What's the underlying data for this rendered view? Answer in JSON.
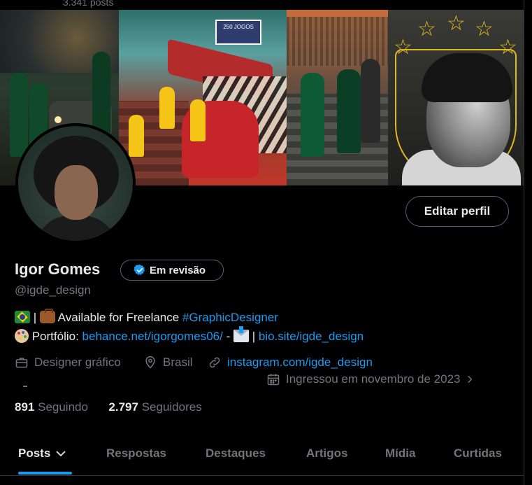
{
  "top": {
    "posts_count": "3.341 posts"
  },
  "banner": {
    "sign_text": "250 JOGOS"
  },
  "profile": {
    "edit_button": "Editar perfil",
    "name": "Igor Gomes",
    "badge": "Em revisão",
    "handle": "@igde_design",
    "bio_line1_sep": " | ",
    "bio_line1_text": " Available for Freelance ",
    "bio_line1_hashtag": "#GraphicDesigner",
    "bio_line2_label": " Portfólio: ",
    "bio_line2_link1": "behance.net/igorgomes06/",
    "bio_line2_dash": " - ",
    "bio_line2_pipe": " | ",
    "bio_line2_link2": "bio.site/igde_design",
    "category": "Designer gráfico",
    "location": "Brasil",
    "website": "instagram.com/igde_design",
    "joined": "Ingressou em novembro de 2023"
  },
  "stats": {
    "following_count": "891",
    "following_label": "Seguindo",
    "followers_count": "2.797",
    "followers_label": "Seguidores"
  },
  "tabs": [
    {
      "label": "Posts"
    },
    {
      "label": "Respostas"
    },
    {
      "label": "Destaques"
    },
    {
      "label": "Artigos"
    },
    {
      "label": "Mídia"
    },
    {
      "label": "Curtidas"
    }
  ],
  "colors": {
    "accent": "#1d9bf0",
    "muted": "#71767b",
    "text": "#e7e9ea",
    "badge_gold": "#e0b81f"
  }
}
